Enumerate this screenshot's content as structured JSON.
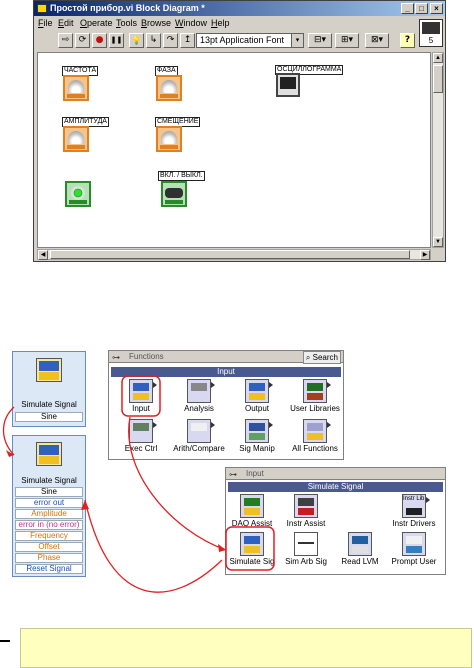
{
  "window": {
    "title": "Простой прибор.vi Block Diagram *",
    "buttons": {
      "minimize": "_",
      "maximize": "□",
      "close": "×"
    }
  },
  "menu": [
    {
      "label": "File",
      "hotkey": "F",
      "rest": "ile"
    },
    {
      "label": "Edit",
      "hotkey": "E",
      "rest": "dit"
    },
    {
      "label": "Operate",
      "hotkey": "O",
      "rest": "perate"
    },
    {
      "label": "Tools",
      "hotkey": "T",
      "rest": "ools"
    },
    {
      "label": "Browse",
      "hotkey": "B",
      "rest": "rowse"
    },
    {
      "label": "Window",
      "hotkey": "W",
      "rest": "indow"
    },
    {
      "label": "Help",
      "hotkey": "H",
      "rest": "elp"
    }
  ],
  "toolbar": {
    "font_select": "13pt Application Font",
    "icons": [
      "run-arrow-icon",
      "run-continuous-icon",
      "abort-icon",
      "pause-icon",
      "highlight-execution-icon",
      "step-into-icon",
      "step-over-icon",
      "step-out-icon",
      "align-icon",
      "distribute-icon",
      "reorder-icon",
      "help-icon"
    ],
    "glyphs": {
      "run": "⇨",
      "cont": "⟳",
      "abort": "●",
      "pause": "❚❚",
      "bulb": "💡",
      "step1": "↳",
      "step2": "↷",
      "step3": "↥",
      "help": "?",
      "dd": "▾"
    },
    "context_number": "5"
  },
  "diagram": {
    "terminals": [
      {
        "name": "frequency",
        "label": "ЧАСТОТА",
        "kind": "knob"
      },
      {
        "name": "phase",
        "label": "ФАЗА",
        "kind": "knob"
      },
      {
        "name": "oscillogram",
        "label": "ОСЦИЛЛОГРАММА",
        "kind": "scope"
      },
      {
        "name": "amplitude",
        "label": "АМПЛИТУДА",
        "kind": "knob"
      },
      {
        "name": "offset",
        "label": "СМЕЩЕНИЕ",
        "kind": "knob"
      },
      {
        "name": "led",
        "label": "",
        "kind": "led"
      },
      {
        "name": "on-off",
        "label": "ВКЛ. / ВЫКЛ.",
        "kind": "switch"
      }
    ]
  },
  "illustration": {
    "sim_block_small": {
      "title": "Simulate Signal",
      "row": "Sine"
    },
    "sim_block_large": {
      "title": "Simulate Signal",
      "rows": [
        "Sine",
        "error out",
        "Amplitude",
        "error in (no error)",
        "Frequency",
        "Offset",
        "Phase",
        "Reset Signal"
      ]
    },
    "functions_palette": {
      "bar_title": "Functions",
      "search_label": "Search",
      "header": "Input",
      "items": [
        "Input",
        "Analysis",
        "Output",
        "User Libraries",
        "Exec Ctrl",
        "Arith/Compare",
        "Sig Manip",
        "All Functions"
      ]
    },
    "input_palette": {
      "bar_title": "Input",
      "header": "Simulate Signal",
      "items": [
        "DAQ Assist",
        "Instr Assist",
        "Instr Drivers",
        "Simulate Sig",
        "Sim Arb Sig",
        "Read LVM",
        "Prompt User"
      ],
      "instr_lib_badge": "Instr Lib"
    },
    "accent_color": "#e02020",
    "palette_header_color": "#4a5a90"
  }
}
